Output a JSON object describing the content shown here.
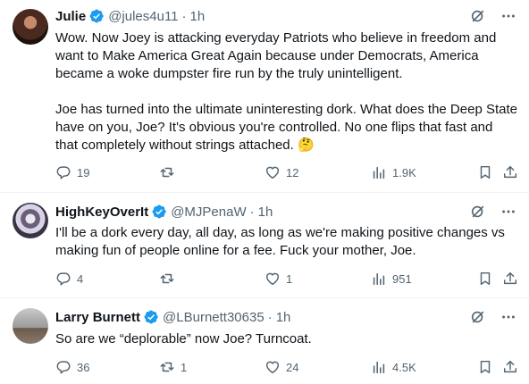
{
  "tweets": [
    {
      "name": "Julie",
      "handle": "@jules4u11",
      "time": "1h",
      "paragraphs": [
        "Wow. Now Joey is attacking everyday Patriots who believe in freedom and want to Make America Great Again because under Democrats, America became a woke dumpster fire run by the truly unintelligent.",
        "Joe has turned into the ultimate uninteresting dork. What does the Deep State have on you, Joe? It's obvious you're controlled. No one flips that fast and that completely without strings attached. 🤔"
      ],
      "replies": "19",
      "retweets": "",
      "likes": "12",
      "views": "1.9K"
    },
    {
      "name": "HighKeyOverIt",
      "handle": "@MJPenaW",
      "time": "1h",
      "paragraphs": [
        "I'll be a dork every day, all day, as long as we're making positive changes vs making fun of people online for a fee. Fuck your mother, Joe."
      ],
      "replies": "4",
      "retweets": "",
      "likes": "1",
      "views": "951"
    },
    {
      "name": "Larry Burnett",
      "handle": "@LBurnett30635",
      "time": "1h",
      "paragraphs": [
        "So are we “deplorable” now Joe? Turncoat."
      ],
      "replies": "36",
      "retweets": "1",
      "likes": "24",
      "views": "4.5K"
    }
  ],
  "separator": "·",
  "colors": {
    "verified": "#1d9bf0",
    "secondary": "#536471",
    "text": "#0f1419"
  },
  "icons": [
    "verified-badge-icon",
    "grok-icon",
    "more-icon",
    "reply-icon",
    "retweet-icon",
    "like-icon",
    "views-icon",
    "bookmark-icon",
    "share-icon"
  ]
}
